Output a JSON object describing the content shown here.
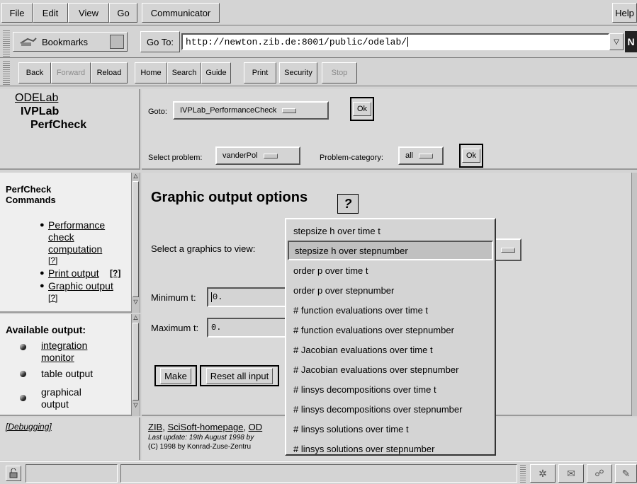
{
  "menubar": {
    "items": [
      "File",
      "Edit",
      "View",
      "Go",
      "Communicator"
    ],
    "help": "Help"
  },
  "locationbar": {
    "bookmarks": "Bookmarks",
    "goto_label": "Go To:",
    "url": "http://newton.zib.de:8001/public/odelab/"
  },
  "toolbar": {
    "buttons": [
      "Back",
      "Forward",
      "Reload",
      "Home",
      "Search",
      "Guide",
      "Print",
      "Security",
      "Stop"
    ]
  },
  "header_frame": {
    "line1": "ODELab",
    "line2": "IVPLab",
    "line3": "PerfCheck"
  },
  "control_frame": {
    "goto_label": "Goto:",
    "goto_value": "IVPLab_PerformanceCheck",
    "ok1": "Ok",
    "select_problem_label": "Select problem:",
    "problem_value": "vanderPol",
    "category_label": "Problem-category:",
    "category_value": "all",
    "ok2": "Ok"
  },
  "commands": {
    "title_line1": "PerfCheck",
    "title_line2": "Commands",
    "items": [
      {
        "lines": [
          "Performance",
          "check",
          "computation"
        ],
        "help": "[?]"
      },
      {
        "lines": [
          "Print output"
        ],
        "help": "[?]"
      },
      {
        "lines": [
          "Graphic output"
        ],
        "help": "[?]"
      }
    ]
  },
  "available": {
    "title": "Available output:",
    "items": [
      {
        "lines": [
          "integration",
          "monitor"
        ],
        "link": true
      },
      {
        "lines": [
          "table output"
        ],
        "link": false
      },
      {
        "lines": [
          "graphical",
          "output"
        ],
        "link": false
      }
    ]
  },
  "main": {
    "heading": "Graphic output options",
    "help_icon": "?",
    "select_label": "Select a graphics to view:",
    "min_label": "Minimum t:",
    "min_value": "0.",
    "max_label": "Maximum t:",
    "max_value": "0.",
    "make": "Make",
    "reset": "Reset all input"
  },
  "dropdown": {
    "options": [
      "stepsize h over time t",
      "stepsize h over stepnumber",
      "order p over time t",
      "order p over stepnumber",
      "# function evaluations over time t",
      "# function evaluations over stepnumber",
      "# Jacobian evaluations over time t",
      "# Jacobian evaluations over stepnumber",
      "# linsys decompositions over time t",
      "# linsys decompositions over stepnumber",
      "# linsys solutions over time t",
      "# linsys solutions over stepnumber"
    ],
    "selected_index": 1
  },
  "footer": {
    "debugging": "[Debugging]",
    "links": [
      "ZIB",
      "SciSoft-homepage",
      "OD"
    ],
    "sep": ", ",
    "last_update": "Last update: 19th August 1998 by",
    "copyright": "(C) 1998 by Konrad-Zuse-Zentru"
  }
}
